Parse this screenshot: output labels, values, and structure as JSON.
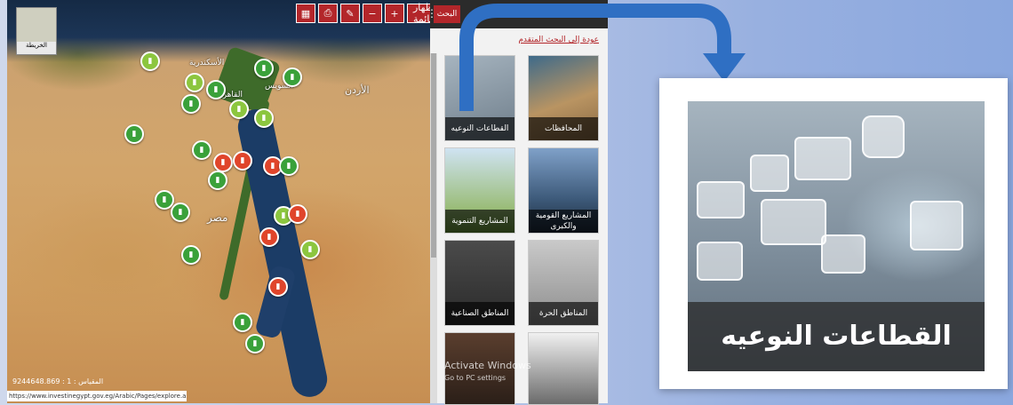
{
  "map": {
    "toolbar": {
      "show_list": "إظهار القائمة",
      "zoom_in": "+",
      "zoom_out": "−"
    },
    "minimap_label": "الخريطة",
    "scale_text": "المقياس : 1 : 9244648.869",
    "status_url": "https://www.investinegypt.gov.eg/Arabic/Pages/explore.aspx?map=true#",
    "labels": {
      "alex": "الأسكندرية",
      "egypt": "مصر",
      "jordan": "الأردن",
      "cairo": "القاهرة",
      "suez": "السويس"
    }
  },
  "panel": {
    "search_tab": "البحث",
    "back_link": "عودة إلى البحث المتقدم",
    "tiles": [
      {
        "label": "المحافظات"
      },
      {
        "label": "القطاعات النوعيه"
      },
      {
        "label": "المشاريع القومية والكبرى"
      },
      {
        "label": "المشاريع التنموية"
      },
      {
        "label": "المناطق الحرة"
      },
      {
        "label": "المناطق الصناعية"
      }
    ],
    "watermark_title": "Activate Windows",
    "watermark_sub": "Go to PC settings"
  },
  "zoom": {
    "label": "القطاعات النوعيه"
  },
  "colors": {
    "brand": "#b3262a",
    "arrow": "#2f6fc3",
    "marker_green": "#3aa13a",
    "marker_red": "#e0452b"
  }
}
